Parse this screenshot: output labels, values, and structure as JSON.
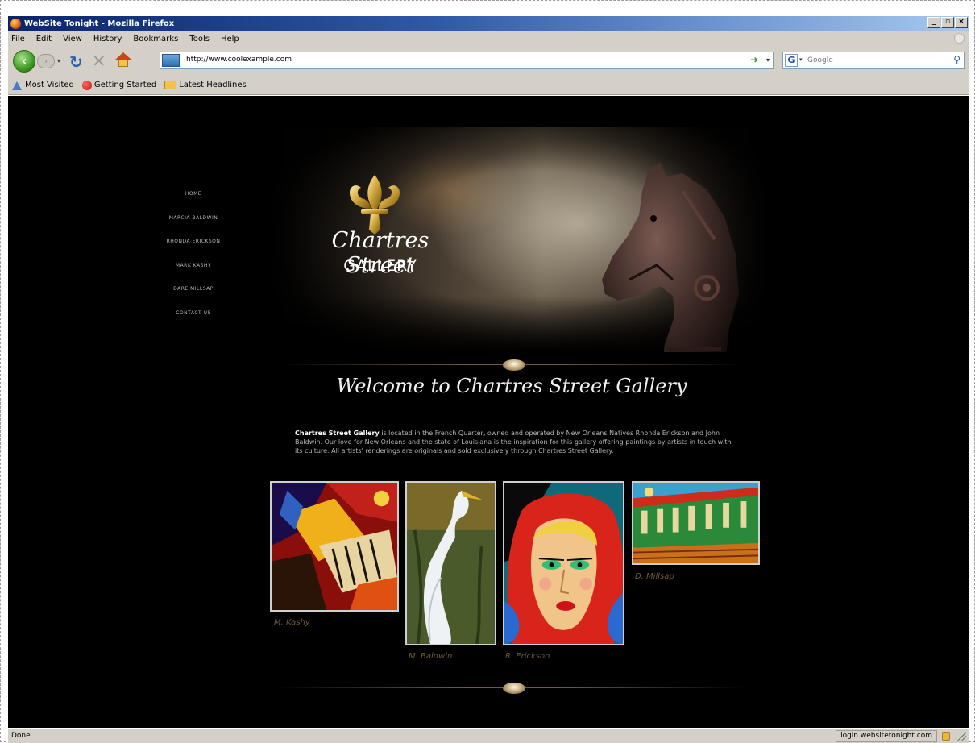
{
  "window": {
    "title": "WebSite Tonight - Mozilla Firefox",
    "controls": {
      "minimize": "_",
      "restore": "▫",
      "close": "×"
    }
  },
  "menu": [
    "File",
    "Edit",
    "View",
    "History",
    "Bookmarks",
    "Tools",
    "Help"
  ],
  "navigation": {
    "url": "http://www.coolexample.com",
    "search_placeholder": "Google",
    "search_engine": "G"
  },
  "bookmarks": [
    "Most Visited",
    "Getting Started",
    "Latest Headlines"
  ],
  "site": {
    "nav": [
      "HOME",
      "MARCIA BALDWIN",
      "RHONDA ERICKSON",
      "MARK KASHY",
      "DARE MILLSAP",
      "CONTACT US"
    ],
    "logo_script": "Chartres Street",
    "logo_word": "GALLERY",
    "welcome": "Welcome to Chartres Street Gallery",
    "intro_brand": "Chartres Street Gallery",
    "intro_text": " is located in the French Quarter, owned and operated by New Orleans Natives Rhonda Erickson and John Baldwin. Our love for New Orleans and the state of Louisiana is the inspiration for this gallery offering paintings by artists in touch with its culture. All artists' renderings are originals and sold exclusively through Chartres Street Gallery.",
    "artists": [
      "M. Kashy",
      "M. Baldwin",
      "R. Erickson",
      "D. Millsap"
    ]
  },
  "status": {
    "text": "Done",
    "host": "login.websitetonight.com"
  },
  "colors": {
    "page_bg": "#000000",
    "chrome": "#d4d0c8",
    "titlebar": "#0a246a",
    "gold": "#c9a24a",
    "caption": "#6e5a3c"
  }
}
